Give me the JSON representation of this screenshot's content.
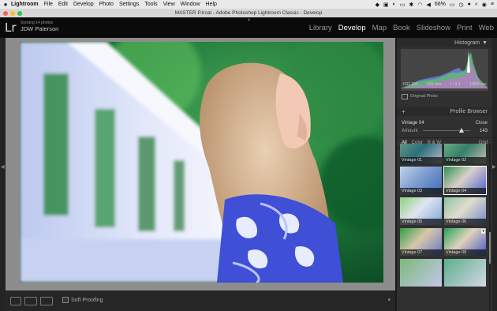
{
  "menubar": {
    "apple": "",
    "app": "Lightroom",
    "items": [
      "File",
      "Edit",
      "Develop",
      "Photo",
      "Settings",
      "Tools",
      "View",
      "Window",
      "Help"
    ],
    "battery": "66%",
    "status_colors": {
      "bg": "#e9e9e9"
    }
  },
  "window": {
    "title": "MASTER P.lrcat - Adobe Photoshop Lightroom Classic - Develop"
  },
  "identity": {
    "logo": "Lr",
    "sync": "Syncing 14 photos",
    "user": "JDW Paterson"
  },
  "modules": [
    "Library",
    "Develop",
    "Map",
    "Book",
    "Slideshow",
    "Print",
    "Web"
  ],
  "active_module": "Develop",
  "histogram": {
    "label": "Histogram",
    "iso": "ISO 100",
    "focal": "105 mm",
    "aperture": "f / 3.2",
    "shutter": "1/800 sec",
    "original_photo": "Original Photo"
  },
  "profile_browser": {
    "plus": "+",
    "title": "Profile Browser",
    "current": "Vintage 04",
    "close": "Close",
    "amount_label": "Amount",
    "amount": "143",
    "amount_fraction": 0.77,
    "filters": [
      "All",
      "Color",
      "B & W"
    ],
    "grid": "Grid",
    "thumbs": [
      "Vintage 01",
      "Vintage 02",
      "Vintage 03",
      "Vintage 04",
      "Vintage 05",
      "Vintage 06",
      "Vintage 07",
      "Vintage 08"
    ],
    "selected": "Vintage 04"
  },
  "toolbar": {
    "soft_proofing": "Soft Proofing"
  },
  "colors": {
    "accent": "#ffffff",
    "panel": "#303030",
    "canvas": "#8d8d8d"
  }
}
